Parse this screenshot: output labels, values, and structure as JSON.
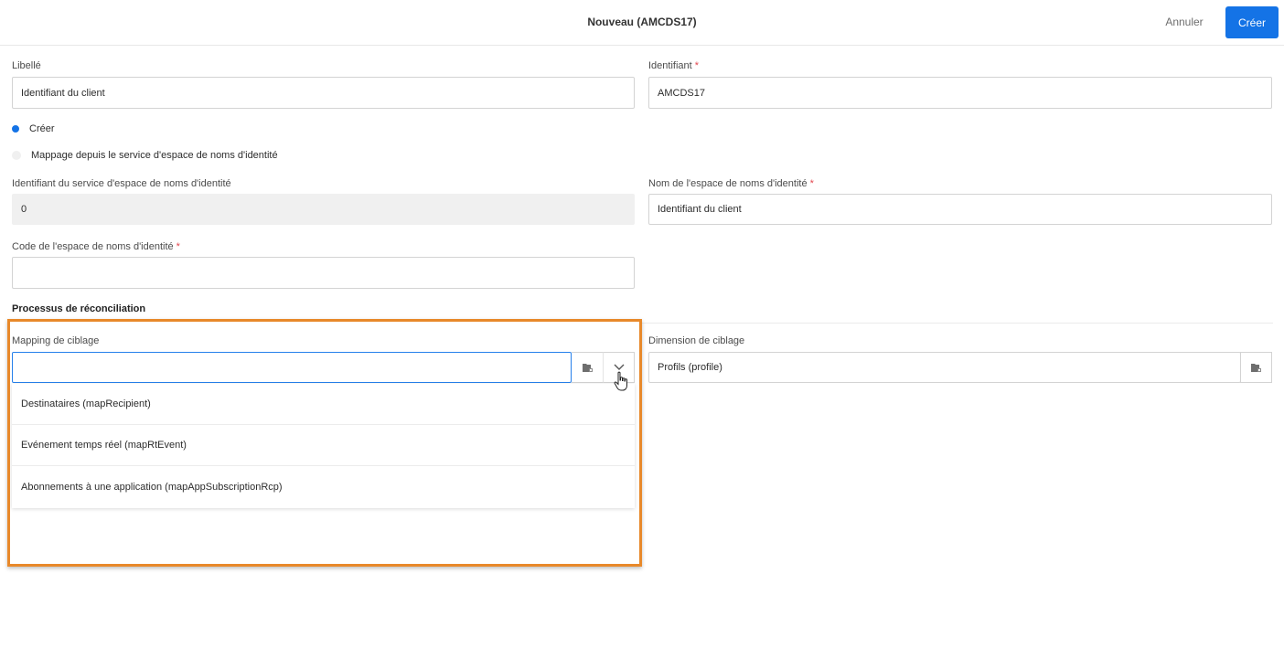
{
  "header": {
    "title": "Nouveau (AMCDS17)",
    "cancel_label": "Annuler",
    "create_label": "Créer"
  },
  "form": {
    "libelle_label": "Libellé",
    "libelle_value": "Identifiant du client",
    "identifiant_label": "Identifiant",
    "identifiant_value": "AMCDS17",
    "required_mark": "*",
    "radio_create_label": "Créer",
    "radio_mapping_label": "Mappage depuis le service d'espace de noms d'identité",
    "service_id_label": "Identifiant du service d'espace de noms d'identité",
    "service_id_value": "0",
    "namespace_name_label": "Nom de l'espace de noms d'identité",
    "namespace_name_value": "Identifiant du client",
    "namespace_code_label": "Code de l'espace de noms d'identité",
    "namespace_code_value": "",
    "section_title": "Processus de réconciliation",
    "mapping_label": "Mapping de ciblage",
    "mapping_value": "",
    "dimension_label": "Dimension de ciblage",
    "dimension_value": "Profils (profile)"
  },
  "dropdown": {
    "options": [
      "Destinataires (mapRecipient)",
      "Evénement temps réel (mapRtEvent)",
      "Abonnements à une application (mapAppSubscriptionRcp)"
    ]
  },
  "colors": {
    "accent": "#1473e6",
    "highlight": "#e8892a",
    "required": "#e34850"
  },
  "icons": {
    "folder": "folder-icon",
    "chevron": "chevron-down-icon",
    "cursor": "hand-cursor-icon"
  }
}
